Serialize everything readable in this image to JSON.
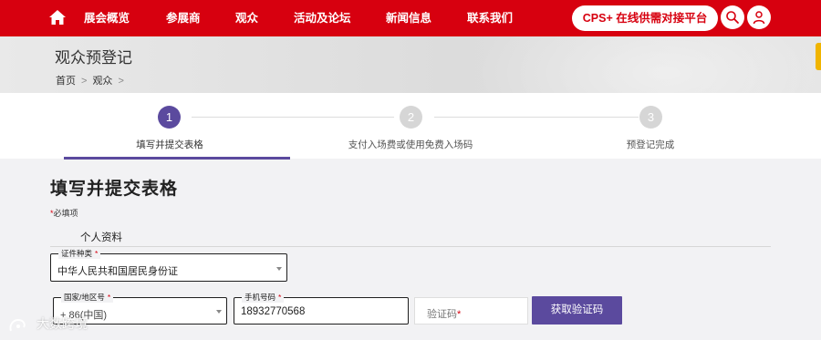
{
  "nav": {
    "items": [
      {
        "label": "展会概览"
      },
      {
        "label": "参展商"
      },
      {
        "label": "观众"
      },
      {
        "label": "活动及论坛"
      },
      {
        "label": "新闻信息"
      },
      {
        "label": "联系我们"
      }
    ],
    "cps_label": "CPS+ 在线供需对接平台",
    "brand_color": "#d7000f",
    "icons": [
      "home-icon",
      "search-icon",
      "user-icon"
    ]
  },
  "banner": {
    "title": "观众预登记",
    "breadcrumb": [
      "首页",
      "观众"
    ]
  },
  "steps": [
    {
      "number": "1",
      "label": "填写并提交表格",
      "state": "active"
    },
    {
      "number": "2",
      "label": "支付入场费或使用免费入场码",
      "state": "pending"
    },
    {
      "number": "3",
      "label": "预登记完成",
      "state": "pending"
    }
  ],
  "accent_color": "#5b4a9e",
  "form": {
    "title": "填写并提交表格",
    "required_note": "必填项",
    "required_mark": "*",
    "section": "个人资料",
    "id_type": {
      "label": "证件种类",
      "value": "中华人民共和国居民身份证"
    },
    "country": {
      "label": "国家/地区号",
      "value": "+ 86(中国)"
    },
    "phone": {
      "label": "手机号码",
      "value": "18932770568"
    },
    "code": {
      "placeholder": "验证码"
    },
    "code_button": "获取验证码"
  },
  "watermark": "大数跨境"
}
